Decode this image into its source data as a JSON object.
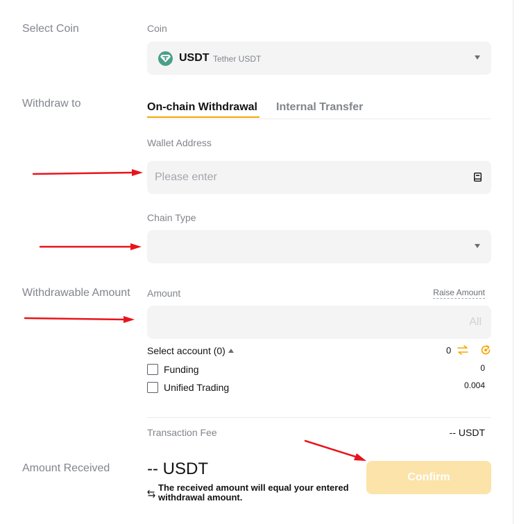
{
  "labels": {
    "select_coin": "Select Coin",
    "withdraw_to": "Withdraw to",
    "withdrawable_amount": "Withdrawable Amount",
    "amount_received": "Amount Received"
  },
  "coin": {
    "label": "Coin",
    "symbol": "USDT",
    "name": "Tether USDT",
    "icon": "tether-icon"
  },
  "tabs": [
    {
      "label": "On-chain Withdrawal",
      "active": true
    },
    {
      "label": "Internal Transfer",
      "active": false
    }
  ],
  "wallet": {
    "label": "Wallet Address",
    "placeholder": "Please enter",
    "value": ""
  },
  "chain": {
    "label": "Chain Type",
    "value": ""
  },
  "amount": {
    "label": "Amount",
    "raise_link": "Raise Amount",
    "all_button": "All",
    "value": ""
  },
  "accounts": {
    "select_label": "Select account (0)",
    "total": "0",
    "items": [
      {
        "label": "Funding",
        "value": "0",
        "checked": false
      },
      {
        "label": "Unified Trading",
        "value": "0.004",
        "checked": false
      }
    ]
  },
  "fee": {
    "label": "Transaction Fee",
    "value": "-- USDT"
  },
  "received": {
    "amount": "-- USDT",
    "note": "The received amount will equal your entered withdrawal amount."
  },
  "confirm_label": "Confirm",
  "colors": {
    "accent": "#f7a600",
    "confirm_disabled_bg": "#fbe3a9",
    "annotation_arrow": "#e8141b"
  }
}
